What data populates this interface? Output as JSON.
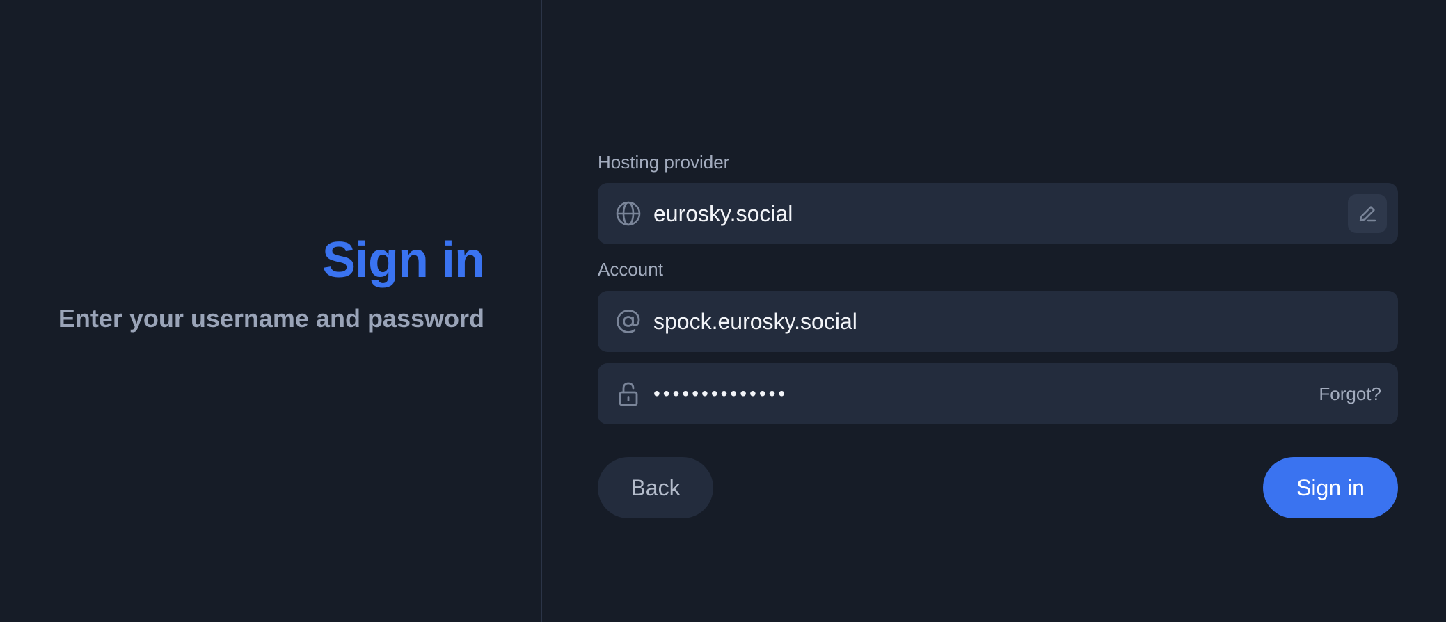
{
  "intro": {
    "title": "Sign in",
    "subtitle": "Enter your username and password"
  },
  "form": {
    "hosting": {
      "label": "Hosting provider",
      "value": "eurosky.social",
      "icon": "globe-icon",
      "edit_icon": "pencil-icon"
    },
    "account": {
      "label": "Account",
      "value": "spock.eurosky.social",
      "icon": "at-sign-icon"
    },
    "password": {
      "masked_value": "••••••••••••••",
      "icon": "lock-icon",
      "forgot_label": "Forgot?"
    }
  },
  "actions": {
    "back_label": "Back",
    "signin_label": "Sign in"
  },
  "colors": {
    "background": "#161c27",
    "field_background": "#232c3d",
    "accent": "#3a73f0",
    "muted_text": "#a3acbe",
    "icon": "#7a8599"
  }
}
